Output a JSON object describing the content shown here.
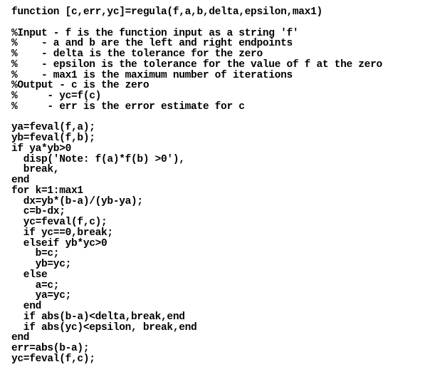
{
  "code": {
    "lines": [
      "function [c,err,yc]=regula(f,a,b,delta,epsilon,max1)",
      "",
      "%Input - f is the function input as a string 'f'",
      "%    - a and b are the left and right endpoints",
      "%    - delta is the tolerance for the zero",
      "%    - epsilon is the tolerance for the value of f at the zero",
      "%    - max1 is the maximum number of iterations",
      "%Output - c is the zero",
      "%     - yc=f(c)",
      "%     - err is the error estimate for c",
      "",
      "ya=feval(f,a);",
      "yb=feval(f,b);",
      "if ya*yb>0",
      "  disp('Note: f(a)*f(b) >0'),",
      "  break,",
      "end",
      "for k=1:max1",
      "  dx=yb*(b-a)/(yb-ya);",
      "  c=b-dx;",
      "  yc=feval(f,c);",
      "  if yc==0,break;",
      "  elseif yb*yc>0",
      "    b=c;",
      "    yb=yc;",
      "  else",
      "    a=c;",
      "    ya=yc;",
      "  end",
      "  if abs(b-a)<delta,break,end",
      "  if abs(yc)<epsilon, break,end",
      "end",
      "err=abs(b-a);",
      "yc=feval(f,c);"
    ]
  }
}
